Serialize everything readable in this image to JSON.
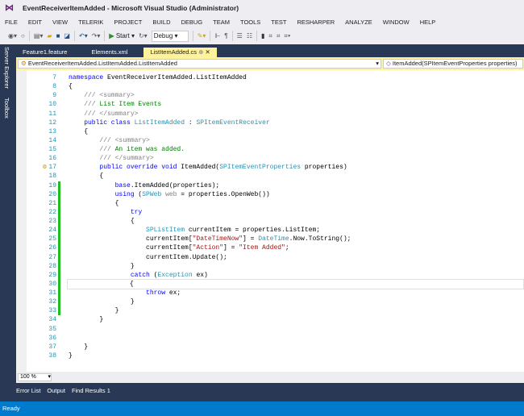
{
  "window": {
    "title": "EventReceiverItemAdded - Microsoft Visual Studio (Administrator)"
  },
  "menu": [
    "FILE",
    "EDIT",
    "VIEW",
    "TELERIK",
    "PROJECT",
    "BUILD",
    "DEBUG",
    "TEAM",
    "TOOLS",
    "TEST",
    "RESHARPER",
    "ANALYZE",
    "WINDOW",
    "HELP"
  ],
  "toolbar": {
    "start_label": "Start",
    "configuration": "Debug"
  },
  "side_tabs": [
    "Server Explorer",
    "Toolbox"
  ],
  "tabs": [
    {
      "label": "Feature1.feature"
    },
    {
      "label": "Elements.xml"
    },
    {
      "label": "ListItemAdded.cs",
      "active": true
    }
  ],
  "navbar": {
    "type": "EventReceiverItemAdded.ListItemAdded.ListItemAdded",
    "member": "ItemAdded(SPItemEventProperties properties)"
  },
  "code": [
    {
      "n": "7",
      "h": "<span class=k>namespace</span> EventReceiverItemAdded.ListItemAdded"
    },
    {
      "n": "8",
      "h": "{"
    },
    {
      "n": "9",
      "h": "    <span class=g>/// &lt;summary&gt;</span>"
    },
    {
      "n": "10",
      "h": "    <span class=g>///</span><span class=c> List Item Events</span>"
    },
    {
      "n": "11",
      "h": "    <span class=g>/// &lt;/summary&gt;</span>"
    },
    {
      "n": "12",
      "h": "    <span class=k>public class</span> <span class=t>ListItemAdded</span> : <span class=t>SPItemEventReceiver</span>"
    },
    {
      "n": "13",
      "h": "    {"
    },
    {
      "n": "14",
      "h": "        <span class=g>/// &lt;summary&gt;</span>"
    },
    {
      "n": "15",
      "h": "        <span class=g>///</span><span class=c> An item was added.</span>"
    },
    {
      "n": "16",
      "h": "        <span class=g>/// &lt;/summary&gt;</span>"
    },
    {
      "n": "17",
      "h": "        <span class=k>public override void</span> ItemAdded(<span class=t>SPItemEventProperties</span> properties)"
    },
    {
      "n": "18",
      "h": "        {"
    },
    {
      "n": "19",
      "h": "            <span class=k>base</span>.ItemAdded(properties);",
      "chg": true
    },
    {
      "n": "20",
      "h": "            <span class=k>using</span> (<span class=t>SPWeb</span> <span class=g>web</span> = properties.OpenWeb())",
      "chg": true
    },
    {
      "n": "21",
      "h": "            {",
      "chg": true
    },
    {
      "n": "22",
      "h": "                <span class=k>try</span>",
      "chg": true
    },
    {
      "n": "23",
      "h": "                {",
      "chg": true
    },
    {
      "n": "24",
      "h": "                    <span class=t>SPListItem</span> currentItem = properties.ListItem;",
      "chg": true
    },
    {
      "n": "25",
      "h": "                    currentItem[<span class=s>\"DateTimeNow\"</span>] = <span class=t>DateTime</span>.Now.ToString();",
      "chg": true
    },
    {
      "n": "26",
      "h": "                    currentItem[<span class=s>\"Action\"</span>] = <span class=s>\"Item Added\"</span>;",
      "chg": true
    },
    {
      "n": "27",
      "h": "                    currentItem.Update();",
      "chg": true
    },
    {
      "n": "28",
      "h": "                }",
      "chg": true
    },
    {
      "n": "29",
      "h": "                <span class=k>catch</span> (<span class=t>Exception</span> ex)",
      "chg": true
    },
    {
      "n": "30",
      "h": "                {",
      "chg": true,
      "cur": true
    },
    {
      "n": "31",
      "h": "                    <span class=k>throw</span> ex;",
      "chg": true
    },
    {
      "n": "32",
      "h": "                }",
      "chg": true
    },
    {
      "n": "33",
      "h": "            }",
      "chg": true
    },
    {
      "n": "34",
      "h": "        }"
    },
    {
      "n": "35",
      "h": ""
    },
    {
      "n": "36",
      "h": ""
    },
    {
      "n": "37",
      "h": "    }"
    },
    {
      "n": "38",
      "h": "}"
    }
  ],
  "zoom": "100 %",
  "bottom_tabs": [
    "Error List",
    "Output",
    "Find Results 1"
  ],
  "status": "Ready"
}
